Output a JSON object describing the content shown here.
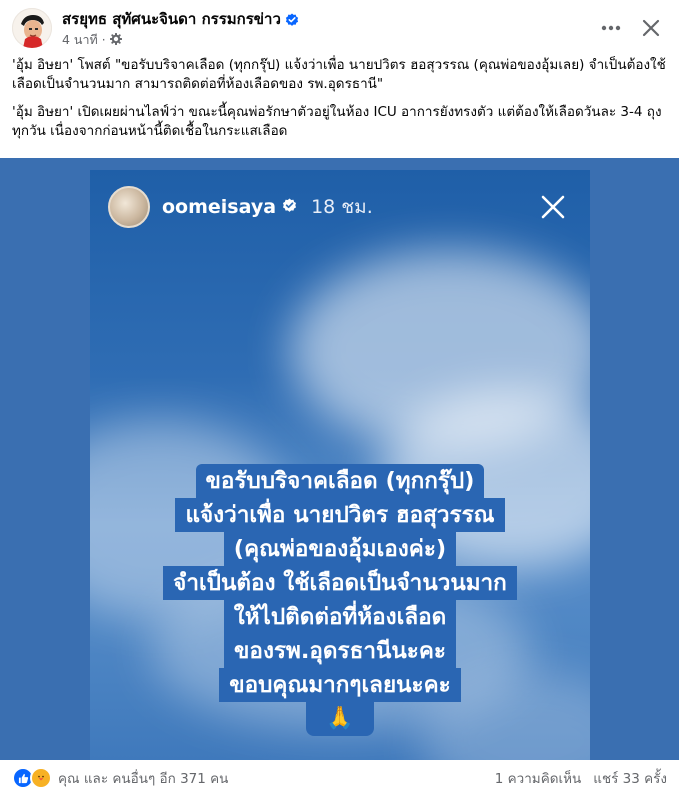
{
  "post": {
    "author": "สรยุทธ สุทัศนะจินดา กรรมกรข่าว",
    "time": "4 นาที",
    "paragraphs": [
      "'อุ้ม อิษยา' โพสต์ \"ขอรับบริจาคเลือด (ทุกกรุ๊ป) แจ้งว่าเพื่อ นายปวิตร ฮอสุวรรณ (คุณพ่อของอุ้มเลย) จำเป็นต้องใช้เลือดเป็นจำนวนมาก สามารถติดต่อที่ห้องเลือดของ รพ.อุดรธานี\"",
      "'อุ้ม อิษยา' เปิดเผยผ่านไลฟ์ว่า ขณะนี้คุณพ่อรักษาตัวอยู่ในห้อง ICU อาการยังทรงตัว แต่ต้องให้เลือดวันละ 3-4 ถุงทุกวัน เนื่องจากก่อนหน้านี้ติดเชื้อในกระแสเลือด"
    ],
    "colors": {
      "verified": "#0866ff",
      "like": "#0866ff",
      "love": "#f5533d",
      "story_bg": "#2f6db4",
      "message_bg": "#2a66b3"
    }
  },
  "story": {
    "username": "oomeisaya",
    "time": "18 ชม.",
    "lines": [
      "ขอรับบริจาคเลือด (ทุกกรุ๊ป)",
      "แจ้งว่าเพื่อ นายปวิตร ฮอสุวรรณ",
      "(คุณพ่อของอุ้มเองค่ะ)",
      "จำเป็นต้อง ใช้เลือดเป็นจำนวนมาก",
      "ให้ไปติดต่อที่ห้องเลือด",
      "ของรพ.อุดรธานีนะคะ",
      "ขอบคุณมากๆเลยนะคะ"
    ],
    "emoji": "🙏"
  },
  "footer": {
    "reactions_text": "คุณ และ คนอื่นๆ อีก 371 คน",
    "comments": "1 ความคิดเห็น",
    "shares": "แชร์ 33 ครั้ง"
  },
  "icons": {
    "more": "more-options-icon",
    "close": "close-icon",
    "privacy": "gear-icon",
    "verified": "verified-badge-icon",
    "like": "like-icon",
    "love": "care-icon"
  }
}
